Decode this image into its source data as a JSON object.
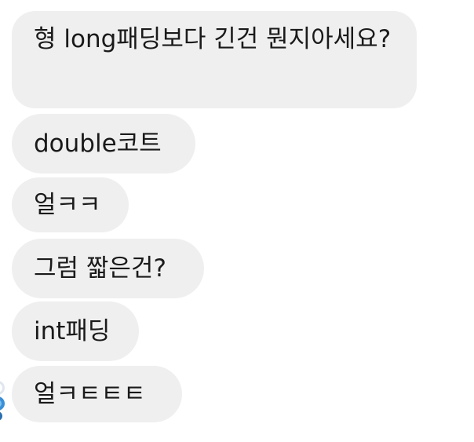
{
  "messages": [
    {
      "text": "형 long패딩보다 긴건 뭔지아세요?"
    },
    {
      "text": "double코트"
    },
    {
      "text": "얼ㅋㅋ"
    },
    {
      "text": "그럼 짧은건?"
    },
    {
      "text": "int패딩"
    },
    {
      "text": "얼ㅋㅌㅌㅌ"
    }
  ],
  "avatar": {
    "icon": "avatar-icon"
  }
}
